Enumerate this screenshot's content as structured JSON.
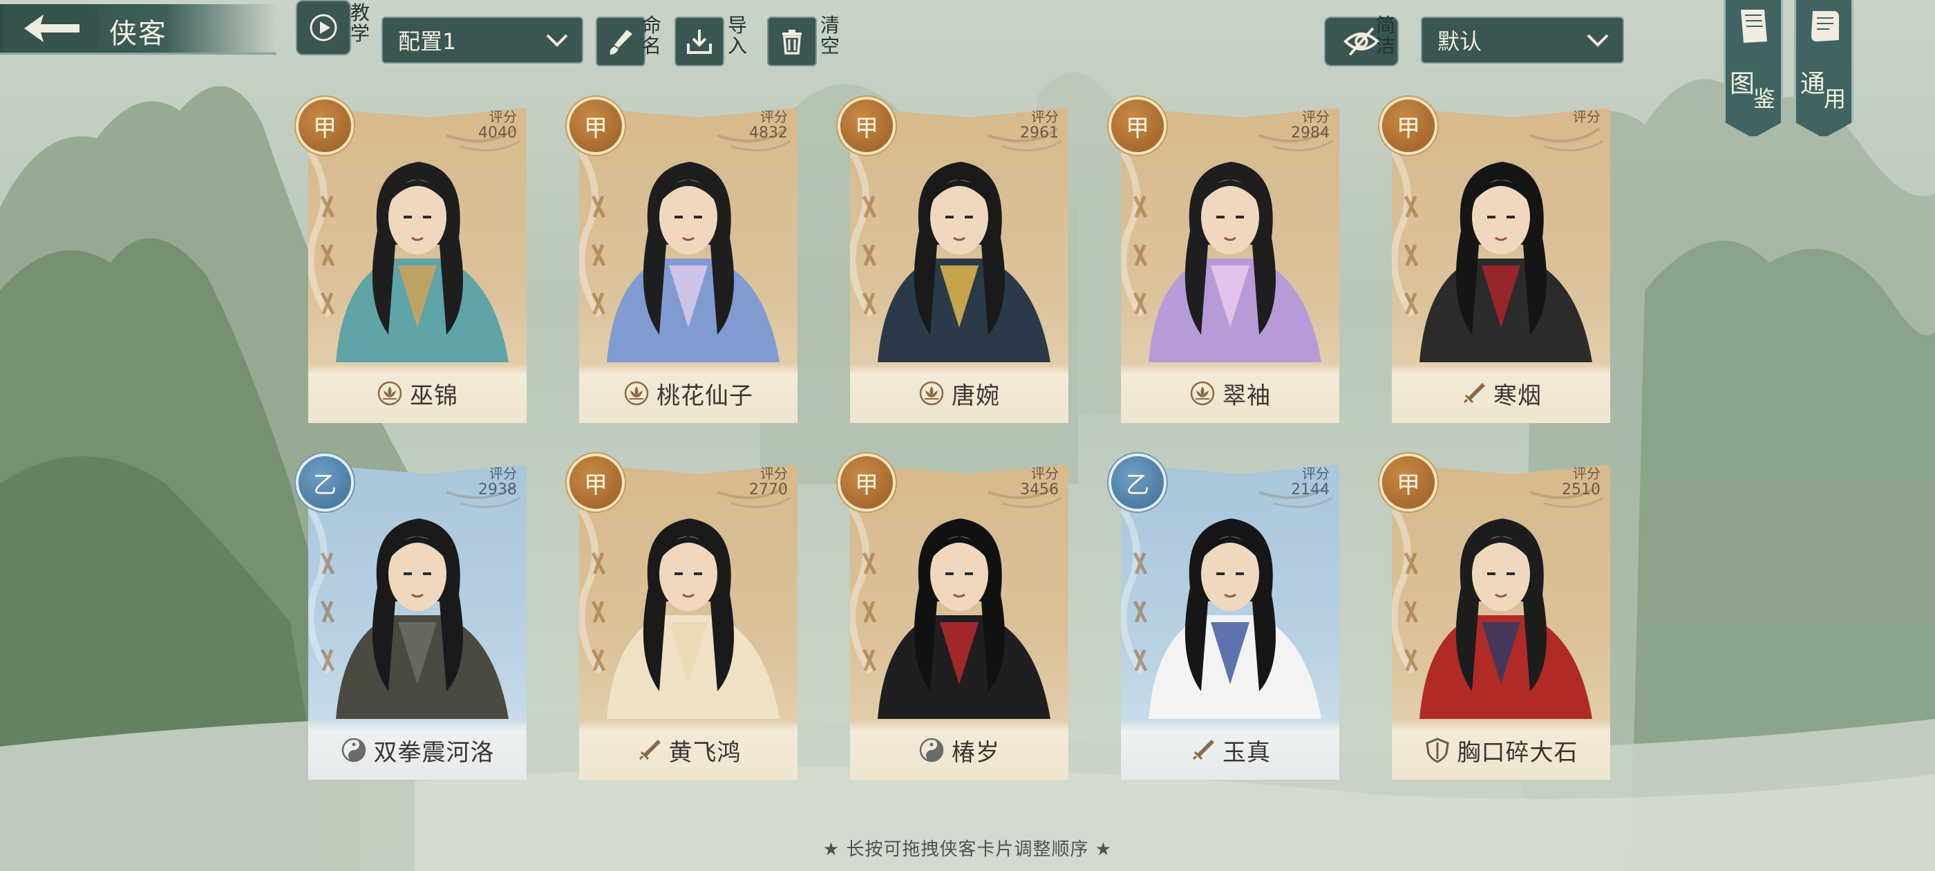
{
  "header": {
    "title": "侠客",
    "tutorial_label": "教学",
    "config_select": "配置1",
    "rename_label": "命名",
    "import_label": "导入",
    "clear_label": "清空",
    "simple_label": "简洁",
    "sort_select": "默认"
  },
  "side_tabs": [
    {
      "line1": "图",
      "line2": "鉴"
    },
    {
      "line1": "通",
      "line2": "用"
    }
  ],
  "score_label": "评分",
  "cards": [
    {
      "grade": "甲",
      "score": "4040",
      "name": "巫锦",
      "tier": "a",
      "type_icon": "lotus-icon"
    },
    {
      "grade": "甲",
      "score": "4832",
      "name": "桃花仙子",
      "tier": "a",
      "type_icon": "lotus-icon"
    },
    {
      "grade": "甲",
      "score": "2961",
      "name": "唐婉",
      "tier": "a",
      "type_icon": "lotus-icon"
    },
    {
      "grade": "甲",
      "score": "2984",
      "name": "翠袖",
      "tier": "a",
      "type_icon": "lotus-icon"
    },
    {
      "grade": "甲",
      "score": "",
      "name": "寒烟",
      "tier": "a",
      "type_icon": "sword-icon"
    },
    {
      "grade": "乙",
      "score": "2938",
      "name": "双拳震河洛",
      "tier": "b",
      "type_icon": "taiji-icon"
    },
    {
      "grade": "甲",
      "score": "2770",
      "name": "黄飞鸿",
      "tier": "a",
      "type_icon": "sword-icon"
    },
    {
      "grade": "甲",
      "score": "3456",
      "name": "椿岁",
      "tier": "a",
      "type_icon": "taiji-icon"
    },
    {
      "grade": "乙",
      "score": "2144",
      "name": "玉真",
      "tier": "b",
      "type_icon": "sword-icon"
    },
    {
      "grade": "甲",
      "score": "2510",
      "name": "胸口碎大石",
      "tier": "a",
      "type_icon": "shield-icon"
    }
  ],
  "hint": "★  长按可拖拽侠客卡片调整顺序  ★",
  "colors": {
    "panel": "#3a5652",
    "tier_a": "#d7b98c",
    "tier_b": "#a9c6dc",
    "grade_a": "#9a5d24",
    "grade_b": "#3f6f98"
  }
}
